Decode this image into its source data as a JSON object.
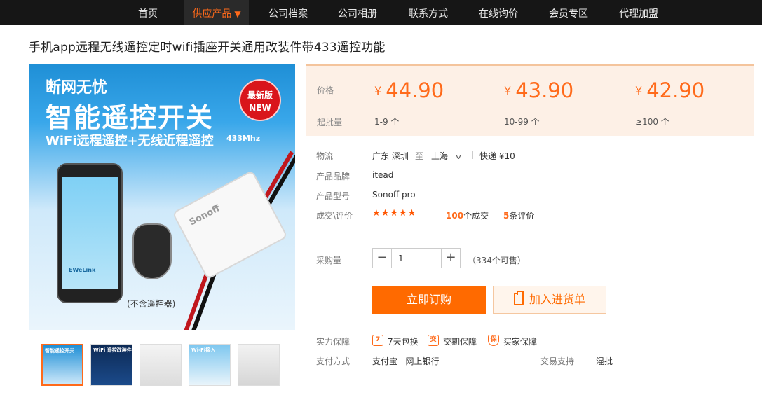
{
  "nav": {
    "items": [
      {
        "label": "首页"
      },
      {
        "label": "供应产品",
        "arrow": "▼"
      },
      {
        "label": "公司档案"
      },
      {
        "label": "公司相册"
      },
      {
        "label": "联系方式"
      },
      {
        "label": "在线询价"
      },
      {
        "label": "会员专区"
      },
      {
        "label": "代理加盟"
      }
    ],
    "active_index": 1,
    "active_color": "#ff6a1a"
  },
  "product": {
    "title": "手机app远程无线遥控定时wifi插座开关通用改装件带433遥控功能",
    "image_texts": {
      "line1": "断网无忧",
      "line2": "智能遥控开关",
      "line3": "WiFi远程遥控+无线近程遥控",
      "freq": "433Mhz",
      "badge_top": "最新版",
      "badge_bottom": "NEW",
      "phone_brand": "EWeLink",
      "device_label": "Sonoff",
      "note": "(不含遥控器)"
    },
    "thumbnails": [
      {
        "caption": "智能遥控开关",
        "selected": true
      },
      {
        "caption": "WiFi 遥控改装件",
        "selected": false
      },
      {
        "caption": "",
        "selected": false
      },
      {
        "caption": "Wi-Fi接入",
        "selected": false
      },
      {
        "caption": "",
        "selected": false
      }
    ]
  },
  "pricing": {
    "price_label": "价格",
    "moq_label": "起批量",
    "currency": "¥",
    "tiers": [
      {
        "price": "44.90",
        "moq": "1-9 个"
      },
      {
        "price": "43.90",
        "moq": "10-99 个"
      },
      {
        "price": "42.90",
        "moq": "≥100 个"
      }
    ],
    "accent_color": "#ff6a1a"
  },
  "attributes": {
    "logistics_label": "物流",
    "from": "广东 深圳",
    "to_word": "至",
    "to_city": "上海",
    "shipping": "快递 ¥10",
    "brand_label": "产品品牌",
    "brand": "itead",
    "model_label": "产品型号",
    "model": "Sonoff pro",
    "deals_label": "成交\\评价",
    "stars": "★★★★★",
    "rating": 5,
    "deals_count": "100",
    "deals_suffix": "个成交",
    "reviews_count": "5",
    "reviews_suffix": "条评价"
  },
  "purchase": {
    "qty_label": "采购量",
    "qty_value": "1",
    "minus": "−",
    "plus": "+",
    "stock": "（334个可售）",
    "buy_label": "立即订购",
    "cart_label": "加入进货单"
  },
  "guarantee": {
    "label": "实力保障",
    "items": [
      {
        "icon_glyph": "7",
        "text": "7天包换"
      },
      {
        "icon_glyph": "交",
        "text": "交期保障"
      },
      {
        "icon_glyph": "保",
        "text": "买家保障"
      }
    ]
  },
  "payment": {
    "label": "支付方式",
    "methods": "支付宝   网上银行",
    "trade_label": "交易支持",
    "trade_value": "混批"
  }
}
